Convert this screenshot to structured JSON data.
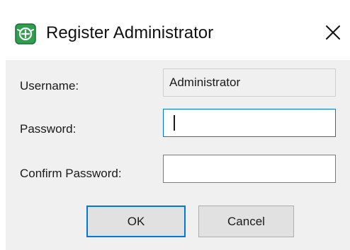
{
  "window": {
    "title": "Register Administrator",
    "app_icon": "app-badge-icon",
    "close_icon": "close-icon",
    "accent_color": "#0078d7",
    "icon_color": "#2e9e4f"
  },
  "form": {
    "username": {
      "label": "Username:",
      "value": "Administrator",
      "readonly": true
    },
    "password": {
      "label": "Password:",
      "value": "",
      "focused": true
    },
    "confirm_password": {
      "label": "Confirm Password:",
      "value": ""
    }
  },
  "buttons": {
    "ok_label": "OK",
    "cancel_label": "Cancel"
  }
}
